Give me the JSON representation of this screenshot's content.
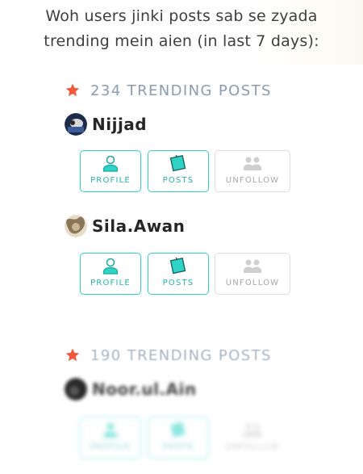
{
  "header": {
    "line1": "Woh users jinki posts sab se zyada",
    "line2": "trending mein aien (in last 7 days):"
  },
  "colors": {
    "accent": "#2ed3c6",
    "star": "#f05a3a",
    "count_text": "#8a9bb2"
  },
  "buttons": {
    "profile": "PROFILE",
    "posts": "POSTS",
    "unfollow": "UNFOLLOW"
  },
  "groups": [
    {
      "count_label": "234 TRENDING POSTS",
      "users": [
        {
          "name": "Nijjad"
        },
        {
          "name": "Sila.Awan"
        }
      ]
    },
    {
      "count_label": "190 TRENDING POSTS",
      "users": [
        {
          "name": "Noor.ul.Ain"
        }
      ]
    }
  ]
}
